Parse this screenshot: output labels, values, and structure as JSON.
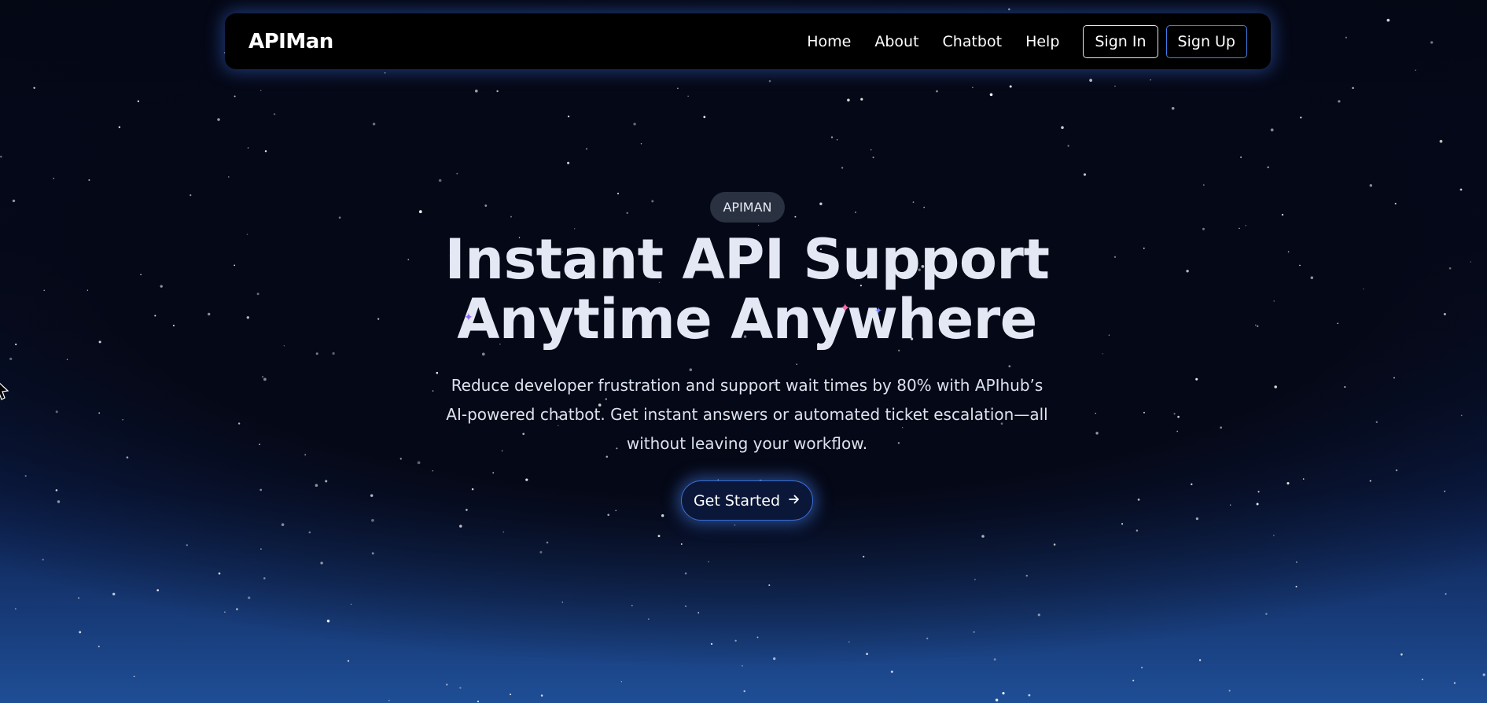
{
  "navbar": {
    "brand": "APIMan",
    "links": [
      "Home",
      "About",
      "Chatbot",
      "Help"
    ],
    "sign_in": "Sign In",
    "sign_up": "Sign Up"
  },
  "hero": {
    "badge": "APIMAN",
    "headline_line1": "Instant API Support",
    "headline_line2": "Anytime Anywhere",
    "subtext": "Reduce developer frustration and support wait times by 80% with APIhub’s AI-powered chatbot. Get instant answers or automated ticket escalation—all without leaving your workflow.",
    "cta_label": "Get Started",
    "cta_icon": "arrow-right-icon"
  },
  "colors": {
    "navbar_bg": "#000000",
    "accent_blue": "#3f7fe6",
    "background_top": "#040714",
    "background_bottom": "#1f4e96",
    "sparkle_pink": "#f06aa8",
    "sparkle_purple": "#8f6cf0"
  }
}
